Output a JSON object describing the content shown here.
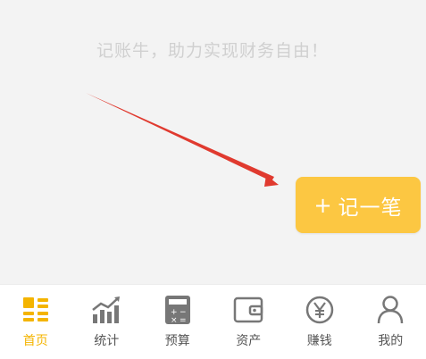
{
  "main": {
    "slogan": "记账牛，助力实现财务自由！",
    "add_button": {
      "plus": "+",
      "label": "记一笔"
    }
  },
  "tabbar": {
    "items": [
      {
        "label": "首页",
        "icon": "home-grid-icon",
        "active": true
      },
      {
        "label": "统计",
        "icon": "chart-icon",
        "active": false
      },
      {
        "label": "预算",
        "icon": "calculator-icon",
        "active": false
      },
      {
        "label": "资产",
        "icon": "wallet-icon",
        "active": false
      },
      {
        "label": "赚钱",
        "icon": "yuan-icon",
        "active": false
      },
      {
        "label": "我的",
        "icon": "person-icon",
        "active": false
      }
    ]
  },
  "colors": {
    "accent": "#fcc742",
    "active_tab": "#f4b400",
    "arrow": "#e03a2f",
    "icon_gray": "#777777"
  }
}
